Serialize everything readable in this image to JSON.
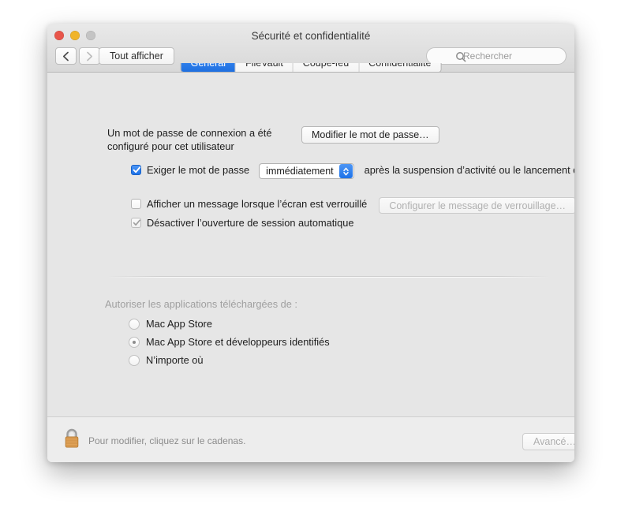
{
  "window": {
    "title": "Sécurité et confidentialité",
    "traffic_lights": [
      "close",
      "minimize",
      "zoom"
    ]
  },
  "toolbar": {
    "back_label": "Précédent",
    "forward_label": "Suivant",
    "show_all_label": "Tout afficher",
    "search_placeholder": "Rechercher",
    "search_value": ""
  },
  "tabs": [
    {
      "label": "Général",
      "selected": true
    },
    {
      "label": "FileVault",
      "selected": false
    },
    {
      "label": "Coupe-feu",
      "selected": false
    },
    {
      "label": "Confidentialité",
      "selected": false
    }
  ],
  "general": {
    "password_status": "Un mot de passe de connexion a été configuré pour cet utilisateur",
    "change_password_button": "Modifier le mot de passe…",
    "require_password": {
      "label": "Exiger le mot de passe",
      "checked": true,
      "interval_value": "immédiatement",
      "trailing_text": "après la suspension d’activité ou le lancement de l’économiseur d’écran"
    },
    "show_message": {
      "label": "Afficher un message lorsque l’écran est verrouillé",
      "checked": false,
      "configure_button": "Configurer le message de verrouillage…",
      "configure_enabled": false
    },
    "disable_auto_login": {
      "label": "Désactiver l’ouverture de session automatique",
      "checked": true,
      "enabled": false
    },
    "download_sources": {
      "label": "Autoriser les applications téléchargées de :",
      "options": [
        {
          "label": "Mac App Store",
          "selected": false
        },
        {
          "label": "Mac App Store et développeurs identifiés",
          "selected": true
        },
        {
          "label": "N’importe où",
          "selected": false
        }
      ]
    }
  },
  "bottom": {
    "lock_icon": "padlock-closed-icon",
    "lock_hint": "Pour modifier, cliquez sur le cadenas.",
    "advanced_button": "Avancé…"
  },
  "colors": {
    "accent_blue": "#1d72e8",
    "window_bg": "#e6e6e6",
    "toolbar_bg": "#dcdcdc",
    "disabled_text": "#a3a3a3",
    "lock_body": "#e0a257"
  }
}
